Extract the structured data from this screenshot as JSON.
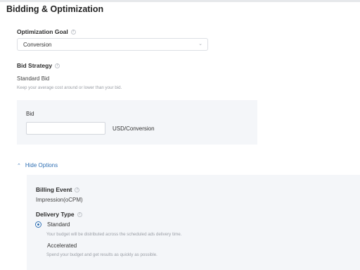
{
  "section": {
    "title": "Bidding & Optimization"
  },
  "optimization_goal": {
    "label": "Optimization Goal",
    "value": "Conversion",
    "info_icon": "info-circle-icon",
    "chevron_icon": "chevron-down-icon"
  },
  "bid_strategy": {
    "label": "Bid Strategy",
    "value": "Standard Bid",
    "help": "Keep your average cost around or lower than your bid.",
    "info_icon": "info-circle-icon"
  },
  "bid": {
    "label": "Bid",
    "value": "",
    "unit": "USD/Conversion"
  },
  "hide_options": {
    "label": "Hide Options",
    "icon": "double-chevron-up-icon"
  },
  "billing_event": {
    "label": "Billing Event",
    "value": "Impression(oCPM)",
    "info_icon": "info-circle-icon"
  },
  "delivery_type": {
    "label": "Delivery Type",
    "info_icon": "info-circle-icon",
    "options": [
      {
        "label": "Standard",
        "description": "Your budget will be distributed across the scheduled ads delivery time.",
        "selected": true
      },
      {
        "label": "Accelerated",
        "description": "Spend your budget and get results as quickly as possible.",
        "selected": false
      }
    ]
  },
  "colors": {
    "accent": "#2f6fb3",
    "panel_bg": "#f4f6f9",
    "border": "#dcdfe4",
    "muted_text": "#9a9ea5"
  }
}
